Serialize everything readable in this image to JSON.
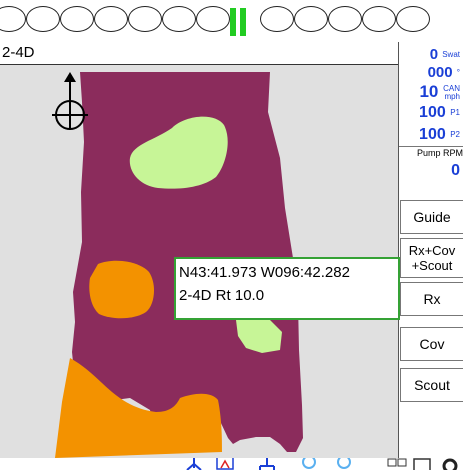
{
  "product": {
    "name": "2-4D"
  },
  "sections": {
    "on_index": 7,
    "count": 13
  },
  "readouts": {
    "swath": {
      "value": "0",
      "unit": "Swat"
    },
    "heading": {
      "value": "000",
      "unit": "°"
    },
    "speed": {
      "value": "10",
      "unit_line1": "CAN",
      "unit_line2": "mph"
    },
    "p1": {
      "value": "100",
      "unit": "P1"
    },
    "p2": {
      "value": "100",
      "unit": "P2"
    },
    "pump_rpm": {
      "label": "Pump RPM",
      "value": "0"
    }
  },
  "buttons": {
    "guide": "Guide",
    "rx_cov_line1": "Rx+Cov",
    "rx_cov_line2": "+Scout",
    "rx": "Rx",
    "cov": "Cov",
    "scout": "Scout"
  },
  "popup": {
    "coords": "N43:41.973  W096:42.282",
    "rate": "2-4D  Rt 10.0"
  },
  "colors": {
    "field": "#8b2c5c",
    "light_zone": "#c7f597",
    "orange_zone": "#f39200",
    "map_bg": "#e0e0e0",
    "accent_blue": "#1a3fd6",
    "section_on": "#22cc22"
  },
  "icons": [
    "north-arrow-icon",
    "guidance-icon",
    "boundary-icon",
    "network-icon",
    "zoom-in-icon",
    "zoom-out-icon",
    "layers-icon",
    "map-view-icon",
    "settings-icon"
  ]
}
